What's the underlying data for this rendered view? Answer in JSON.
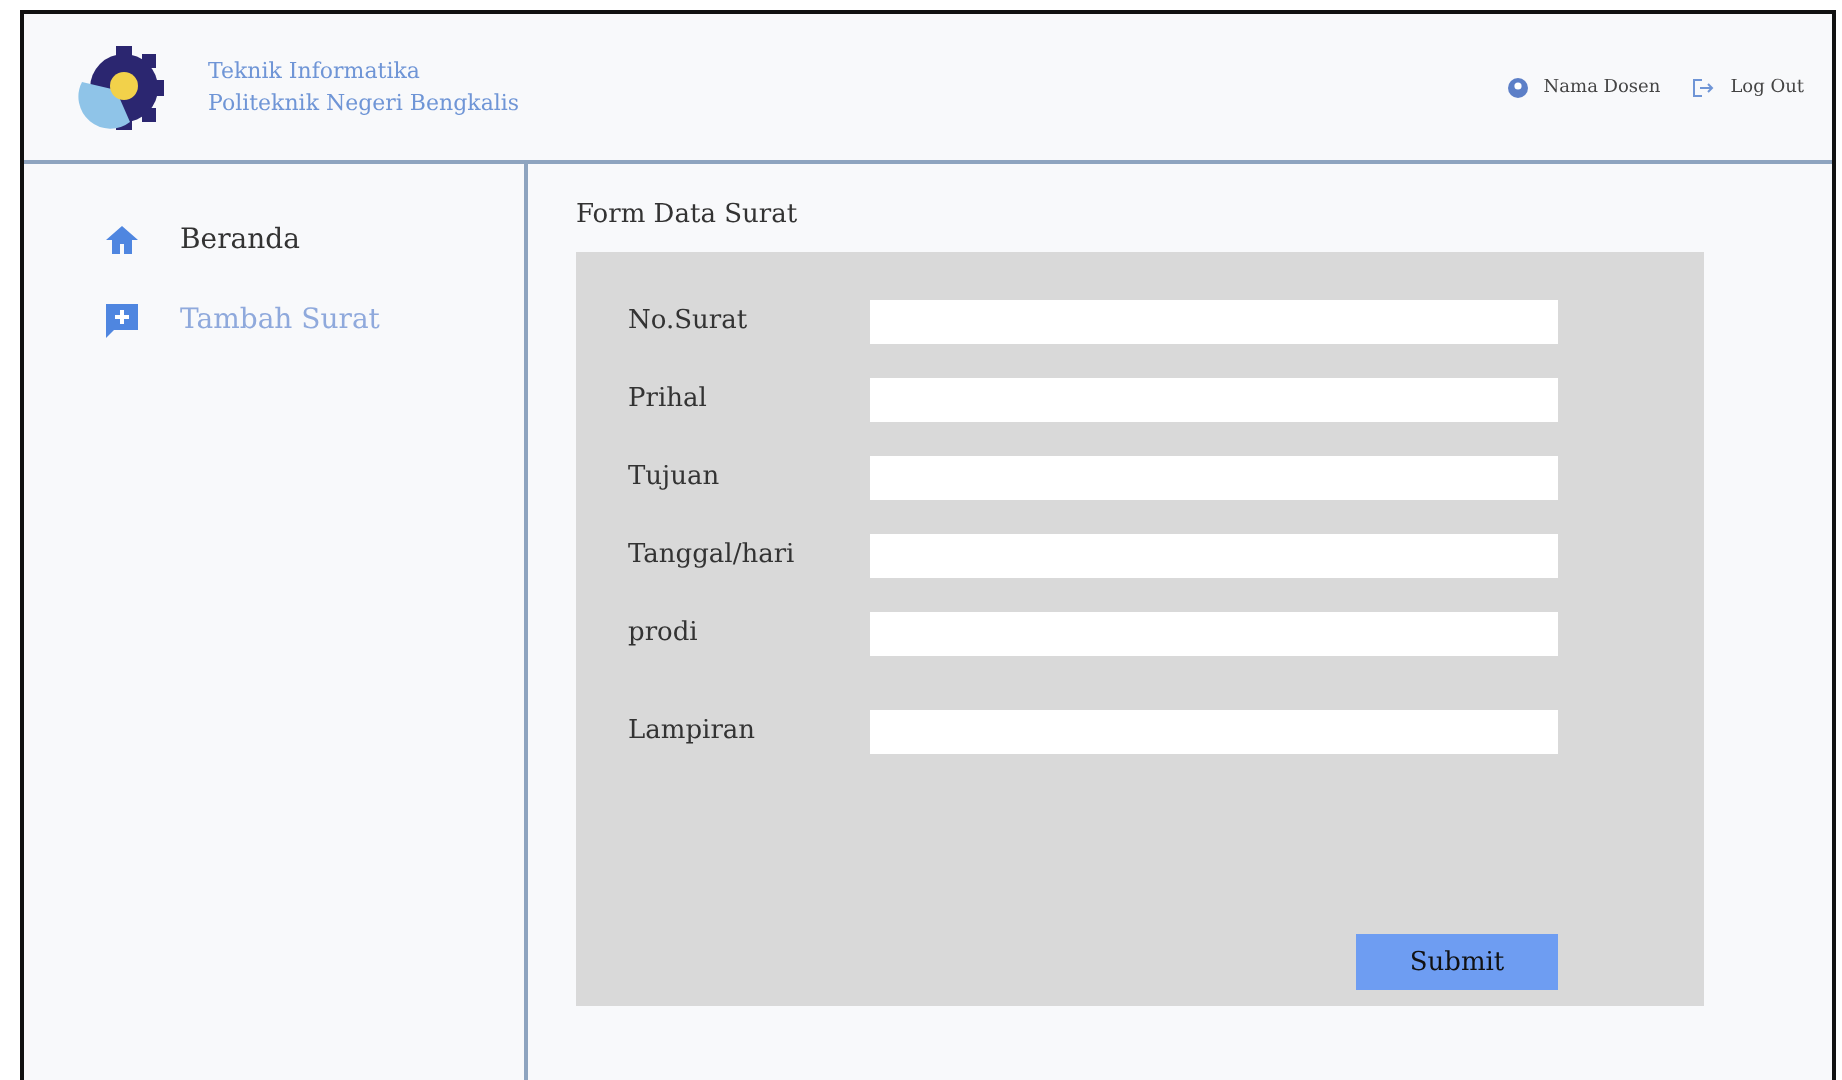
{
  "header": {
    "title_lines": [
      "Teknik Informatika",
      "Politeknik Negeri Bengkalis"
    ],
    "user": "Nama Dosen",
    "logout": "Log Out"
  },
  "sidebar": {
    "items": [
      {
        "label": "Beranda",
        "kind": "home",
        "selected": false
      },
      {
        "label": "Tambah Surat",
        "kind": "add",
        "selected": true
      }
    ]
  },
  "form": {
    "title": "Form Data Surat",
    "fields": [
      {
        "label": "No.Surat"
      },
      {
        "label": "Prihal"
      },
      {
        "label": "Tujuan"
      },
      {
        "label": "Tanggal/hari"
      },
      {
        "label": "prodi"
      },
      {
        "label": "Lampiran",
        "kind": "spaced"
      }
    ],
    "submit": "Submit"
  }
}
